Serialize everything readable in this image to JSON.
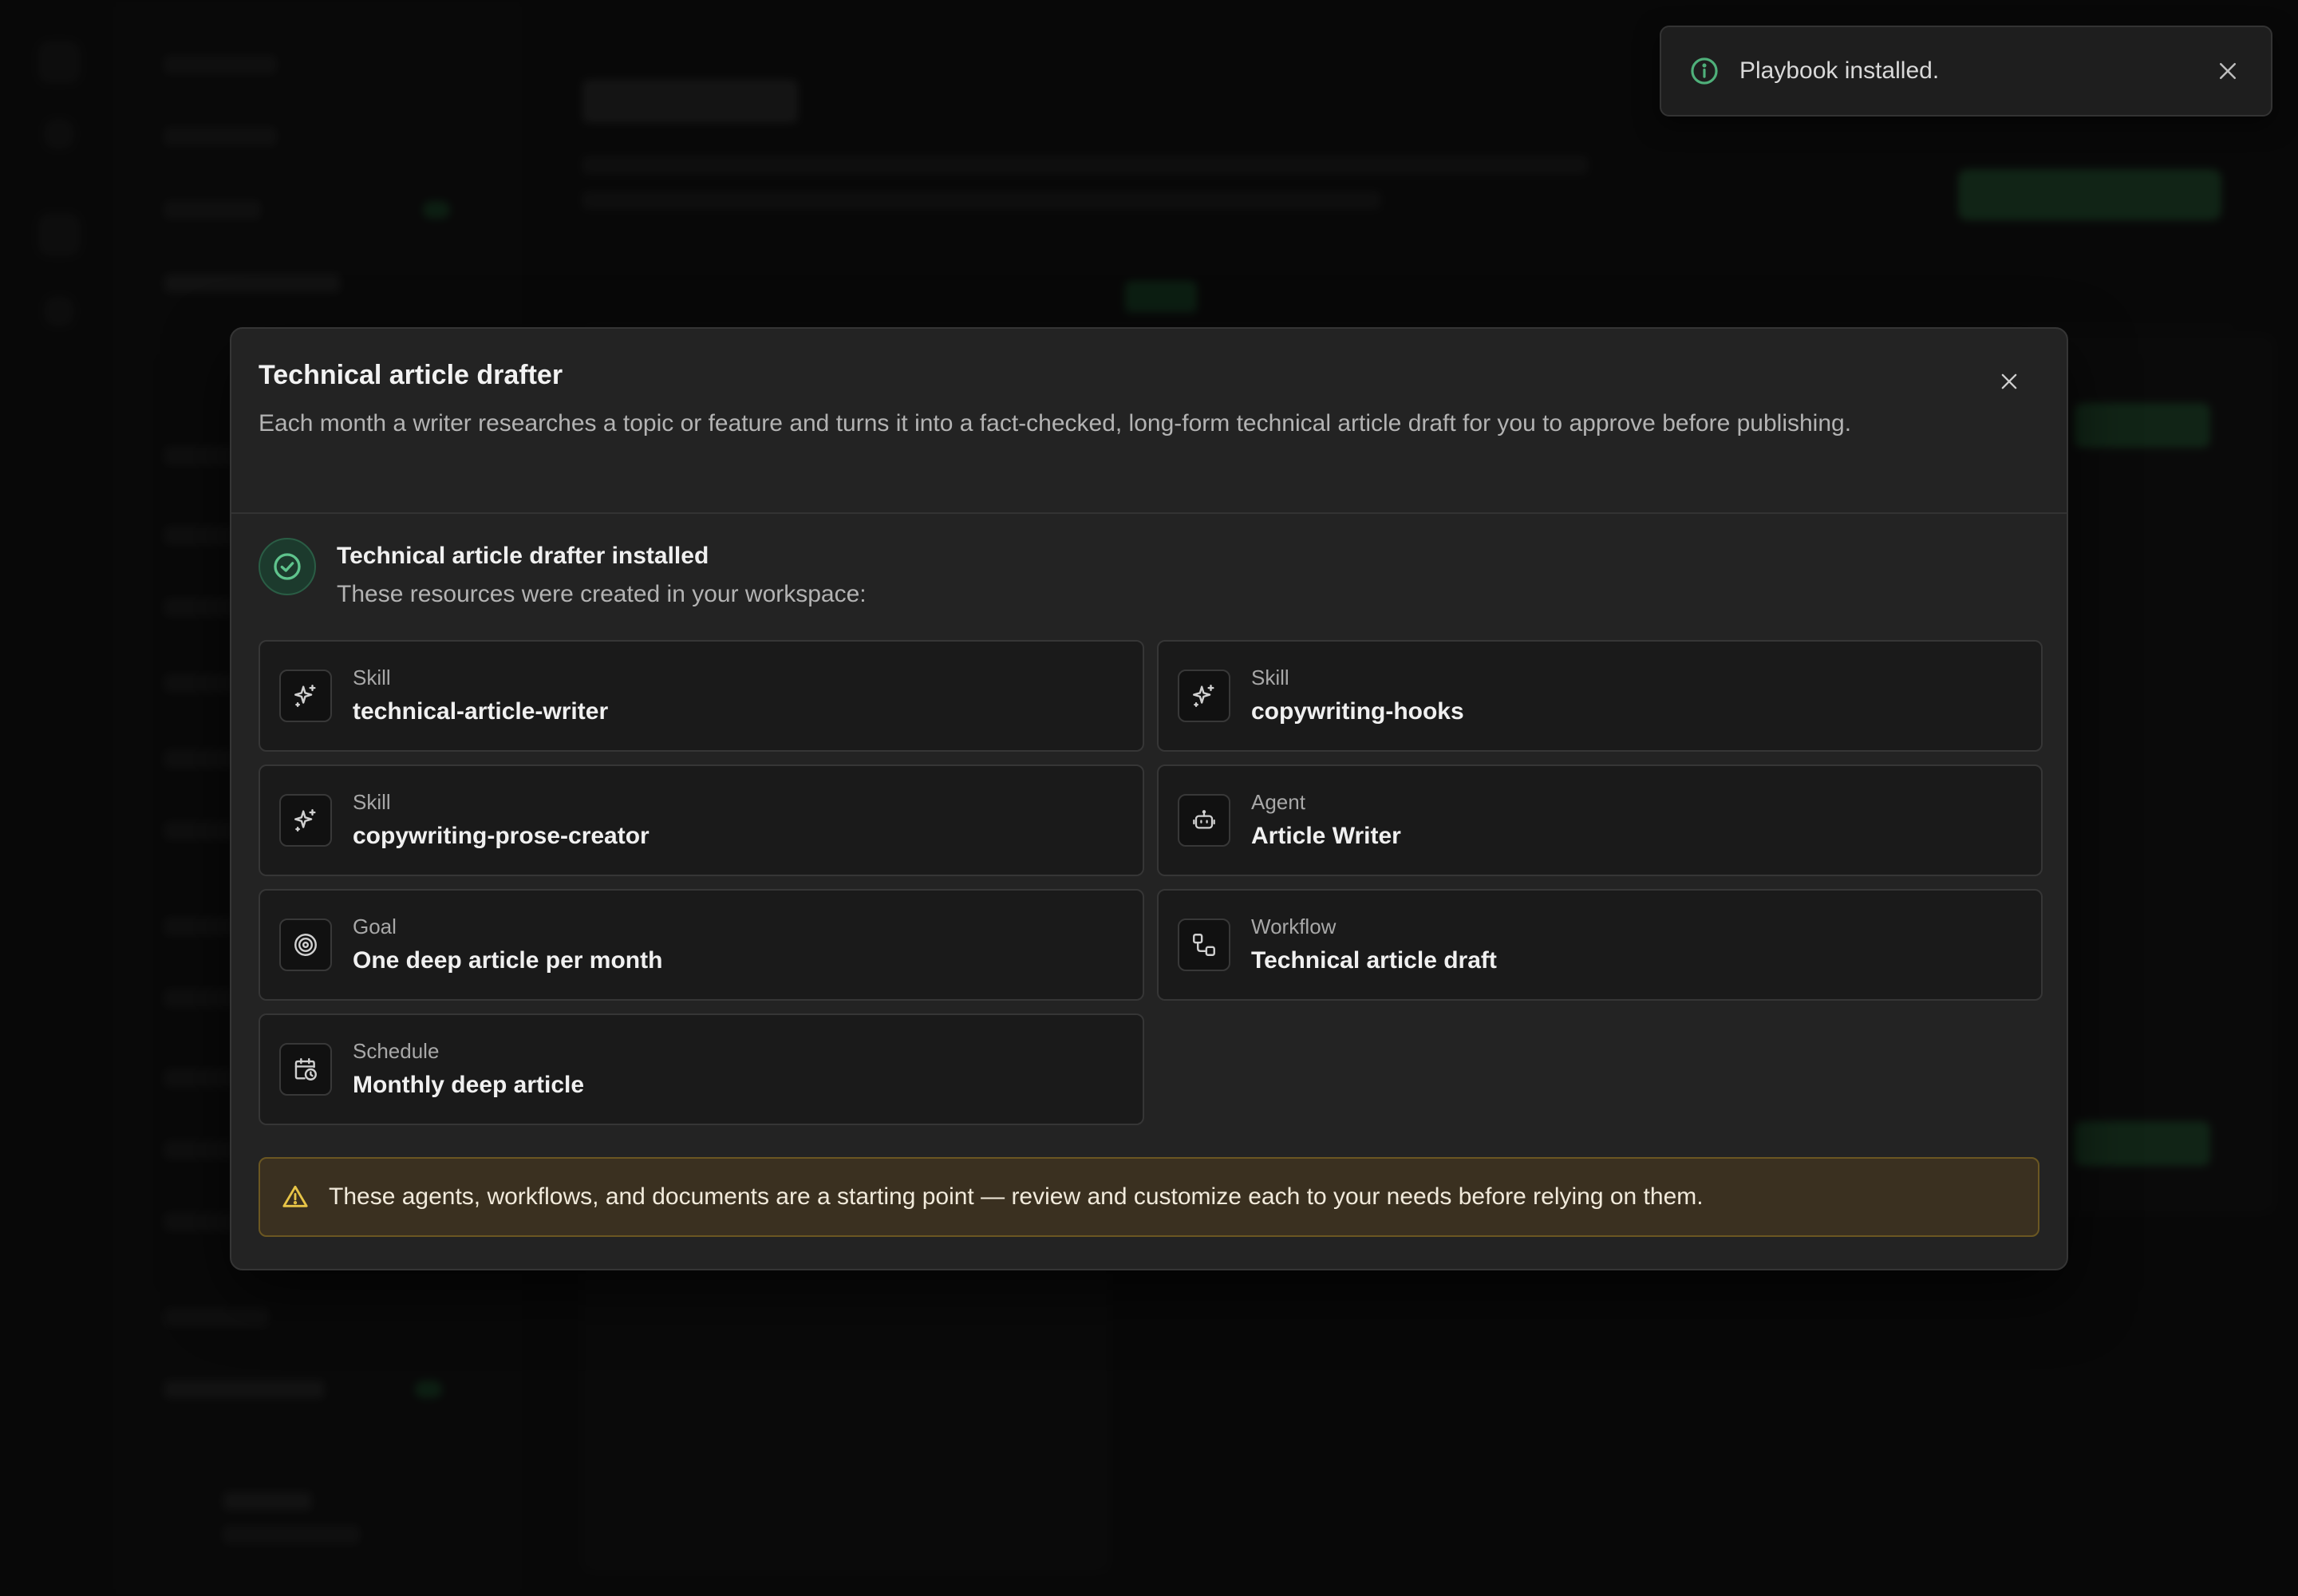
{
  "toast": {
    "icon": "info-icon",
    "message": "Playbook installed.",
    "close_icon": "close-icon"
  },
  "modal": {
    "title": "Technical article drafter",
    "description": "Each month a writer researches a topic or feature and turns it into a fact-checked, long-form technical article draft for you to approve before publishing.",
    "close_icon": "close-icon",
    "installed": {
      "icon": "check-circle-icon",
      "title": "Technical article drafter installed",
      "subtitle": "These resources were created in your workspace:"
    },
    "resources": [
      {
        "type": "Skill",
        "name": "technical-article-writer",
        "icon": "sparkle-icon"
      },
      {
        "type": "Skill",
        "name": "copywriting-hooks",
        "icon": "sparkle-icon"
      },
      {
        "type": "Skill",
        "name": "copywriting-prose-creator",
        "icon": "sparkle-icon"
      },
      {
        "type": "Agent",
        "name": "Article Writer",
        "icon": "robot-icon"
      },
      {
        "type": "Goal",
        "name": "One deep article per month",
        "icon": "target-icon"
      },
      {
        "type": "Workflow",
        "name": "Technical article draft",
        "icon": "workflow-icon"
      },
      {
        "type": "Schedule",
        "name": "Monthly deep article",
        "icon": "calendar-clock-icon"
      }
    ],
    "warning": {
      "icon": "warning-icon",
      "text": "These agents, workflows, and documents are a starting point — review and customize each to your needs before relying on them."
    }
  },
  "colors": {
    "accent_green": "#4fb07a",
    "warning_yellow": "#e8c547",
    "modal_bg": "#232323",
    "card_bg": "#1a1a1a"
  }
}
